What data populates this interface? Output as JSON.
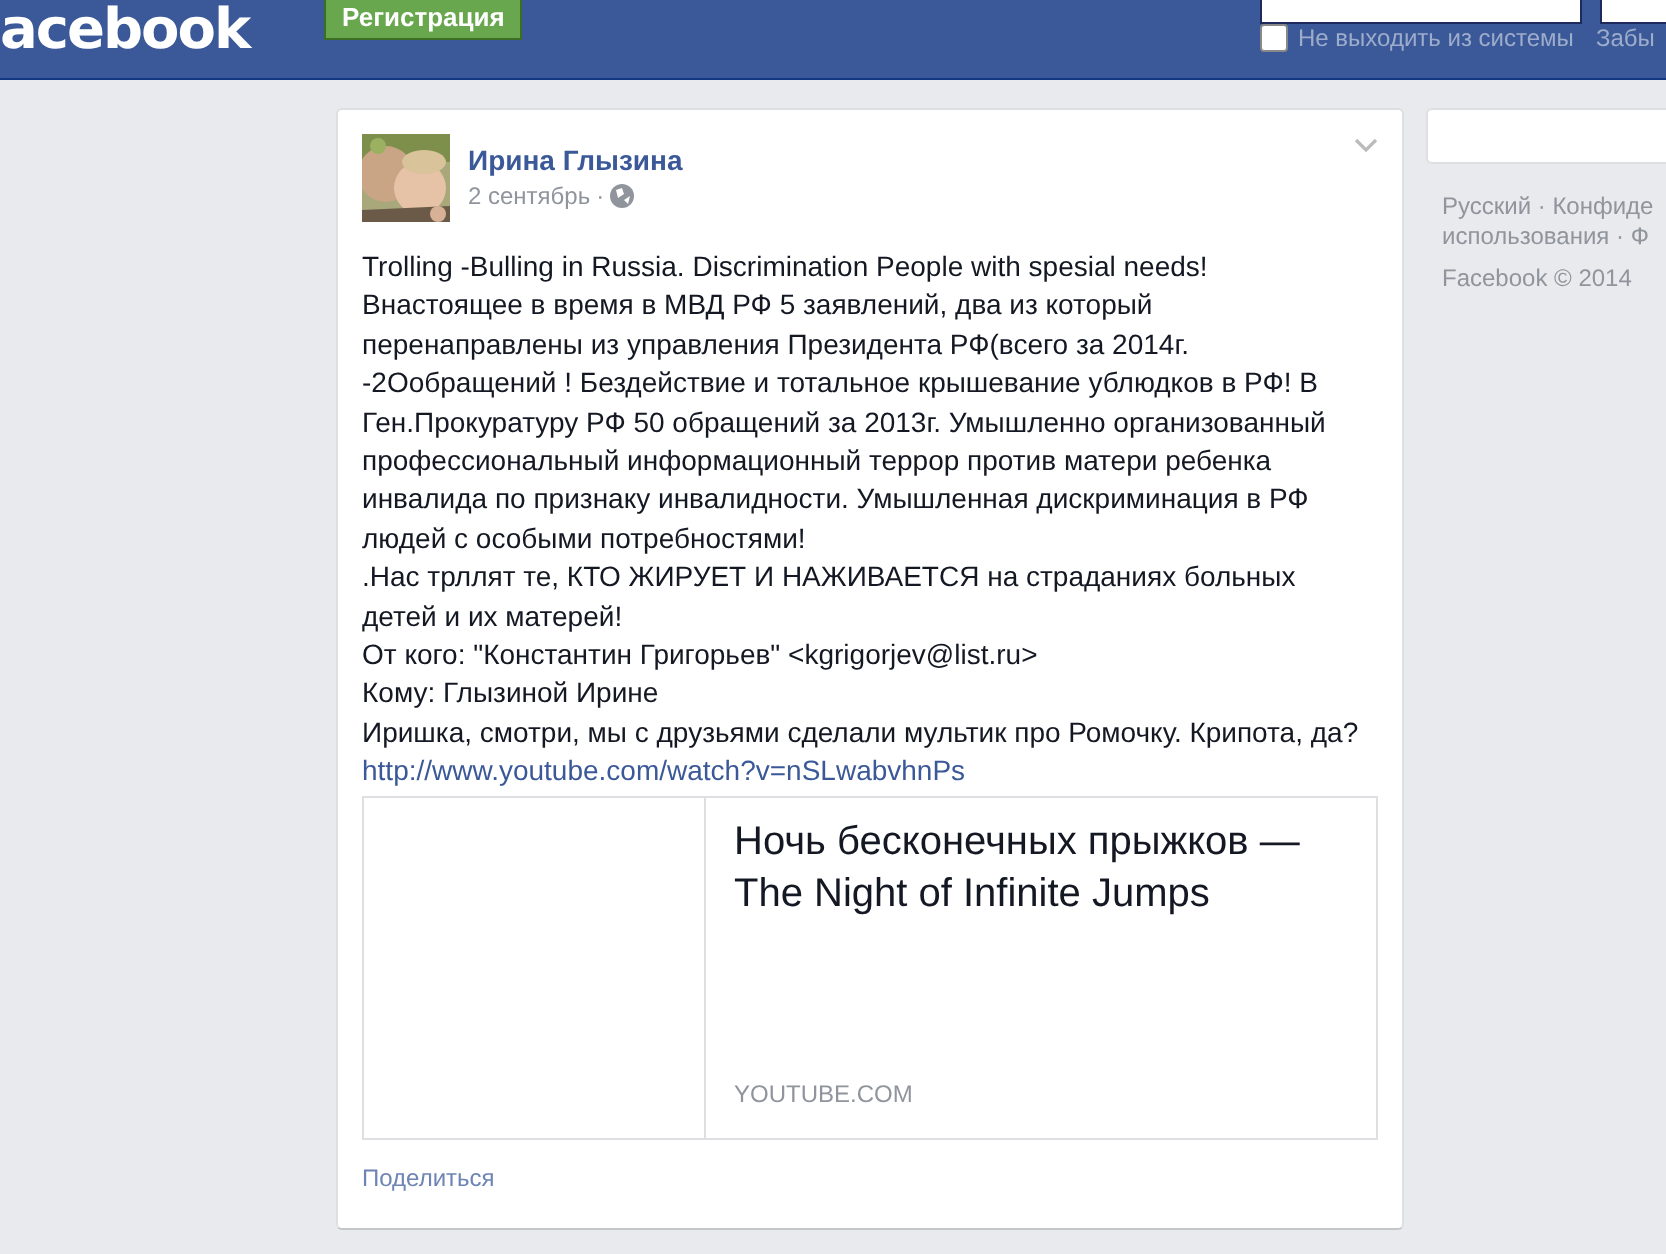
{
  "header": {
    "logo": "acebook",
    "register_button": "Регистрация",
    "remember": {
      "label": "Не выходить из системы",
      "checked": false
    },
    "forgot_link": "Забы"
  },
  "post": {
    "author": "Ирина Глызина",
    "date": "2 сентябрь",
    "separator": "·",
    "text_lines": [
      "Trolling -Bulling in Russia. Discrimination People with spesial needs!",
      "Внастоящее в время в МВД РФ 5 заявлений, два из который",
      "перенаправлены из управления Президента РФ(всего за 2014г.",
      "-2Oобращений ! Бездействие и тотальное крышевание ублюдков в РФ! В",
      "Ген.Прокуратуру РФ 50 обращений за 2013г. Умышленно организованный",
      "профессиональный информационный террор против матери ребенка",
      "инвалида по признаку инвалидности. Умышленная дискриминация в РФ",
      "людей с особыми потребностями!",
      ".Нас трллят те, КТО ЖИРУЕТ И НАЖИВАЕТСЯ на страданиях больных",
      "детей и их матерей!",
      "От кого: \"Константин Григорьев\" <kgrigorjev@list.ru>",
      "Кому: Глызиной Ирине",
      "Иришка, смотри, мы с друзьями сделали мультик про Ромочку. Крипота, да?"
    ],
    "link": "http://www.youtube.com/watch?v=nSLwabvhnPs",
    "preview": {
      "title_lines": [
        "Ночь бесконечных прыжков —",
        "The Night of Infinite Jumps"
      ],
      "domain": "YOUTUBE.COM"
    },
    "share": "Поделиться"
  },
  "sidebar": {
    "footer_lines": [
      "Русский · Конфиде",
      "использования · Ф"
    ],
    "copyright": "Facebook © 2014"
  }
}
